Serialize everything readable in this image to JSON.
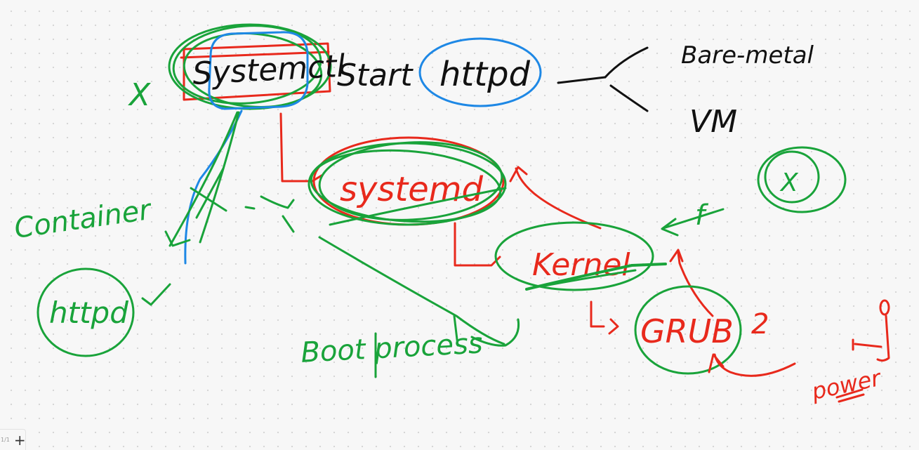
{
  "colors": {
    "black_ink": "#111111",
    "green_ink": "#19a33a",
    "red_ink": "#e8291c",
    "blue_ink": "#1e88e5",
    "canvas_background": "#f7f7f7"
  },
  "notes": {
    "systemctl": "Systemctl",
    "start": "Start",
    "httpd_top": "httpd",
    "bare_metal": "Bare-metal",
    "vm": "VM",
    "container": "Container",
    "httpd_bottom": "httpd",
    "systemd": "systemd",
    "kernel": "Kernel",
    "grub": "GRUB",
    "grub_version": "2",
    "boot_process": "Boot process",
    "power": "power",
    "x_mark": "X",
    "f_mark": "f"
  },
  "footer": {
    "page_number": "1/1",
    "add_page": "+"
  }
}
